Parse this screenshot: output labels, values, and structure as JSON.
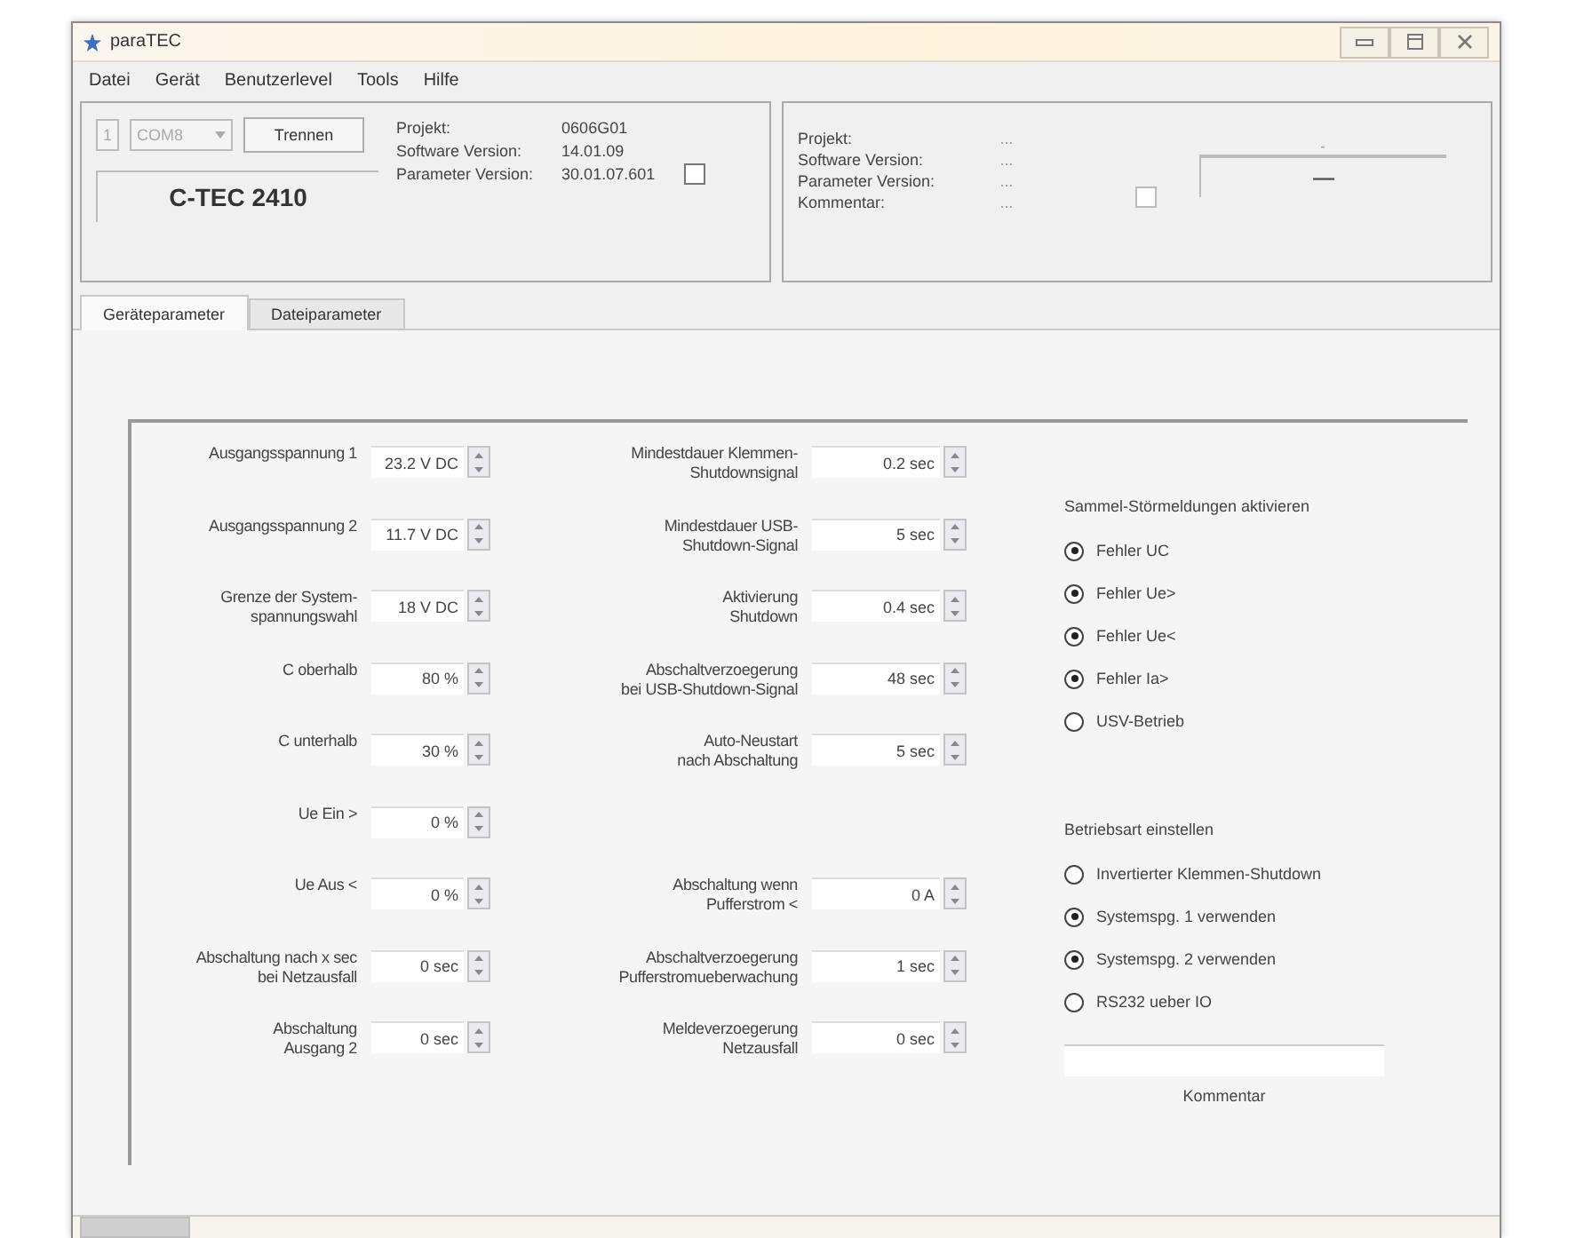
{
  "window": {
    "title": "paraTEC"
  },
  "menu": [
    "Datei",
    "Gerät",
    "Benutzerlevel",
    "Tools",
    "Hilfe"
  ],
  "connection": {
    "port_index": "1",
    "port": "COM8",
    "button": "Trennen",
    "device": "C-TEC 2410"
  },
  "device_info": [
    {
      "label": "Projekt:",
      "value": "0606G01"
    },
    {
      "label": "Software Version:",
      "value": "14.01.09"
    },
    {
      "label": "Parameter Version:",
      "value": "30.01.07.601"
    }
  ],
  "device_checkbox": {
    "checked": false
  },
  "file_info": [
    {
      "label": "Projekt:",
      "value": "..."
    },
    {
      "label": "Software Version:",
      "value": "..."
    },
    {
      "label": "Parameter Version:",
      "value": "..."
    },
    {
      "label": "Kommentar:",
      "value": "..."
    }
  ],
  "file_checkbox": {
    "checked": false
  },
  "file_display": {
    "caption": "-",
    "value": "—"
  },
  "tabs": [
    {
      "label": "Geräteparameter",
      "selected": true
    },
    {
      "label": "Dateiparameter",
      "selected": false
    }
  ],
  "rows": [
    {
      "left": {
        "label": "Ausgangsspannung 1",
        "value": "23.2 V DC"
      },
      "right": {
        "label": "Mindestdauer Klemmen-\nShutdownsignal",
        "value": "0.2 sec"
      }
    },
    {
      "left": {
        "label": "Ausgangsspannung 2",
        "value": "11.7 V DC"
      },
      "right": {
        "label": "Mindestdauer USB-\nShutdown-Signal",
        "value": "5 sec"
      }
    },
    {
      "left": {
        "label": "Grenze der System-\nspannungswahl",
        "value": "18 V DC"
      },
      "right": {
        "label": "Aktivierung\nShutdown",
        "value": "0.4 sec"
      }
    },
    {
      "left": {
        "label": "C oberhalb",
        "value": "80 %"
      },
      "right": {
        "label": "Abschaltverzoegerung\nbei USB-Shutdown-Signal",
        "value": "48 sec"
      }
    },
    {
      "left": {
        "label": "C unterhalb",
        "value": "30 %"
      },
      "right": {
        "label": "Auto-Neustart\nnach Abschaltung",
        "value": "5 sec"
      }
    },
    {
      "left": {
        "label": "Ue Ein >",
        "value": "0 %"
      }
    },
    {
      "left": {
        "label": "Ue Aus <",
        "value": "0 %"
      },
      "right": {
        "label": "Abschaltung wenn\nPufferstrom <",
        "value": "0 A"
      }
    },
    {
      "left": {
        "label": "Abschaltung nach x sec\nbei Netzausfall",
        "value": "0 sec"
      },
      "right": {
        "label": "Abschaltverzoegerung\nPufferstromueberwachung",
        "value": "1 sec"
      }
    },
    {
      "left": {
        "label": "Abschaltung\nAusgang 2",
        "value": "0 sec"
      },
      "right": {
        "label": "Meldeverzoegerung\nNetzausfall",
        "value": "0 sec"
      }
    }
  ],
  "groups": [
    {
      "title": "Sammel-Störmeldungen aktivieren",
      "options": [
        {
          "label": "Fehler UC",
          "checked": true
        },
        {
          "label": "Fehler Ue>",
          "checked": true
        },
        {
          "label": "Fehler Ue<",
          "checked": true
        },
        {
          "label": "Fehler Ia>",
          "checked": true
        },
        {
          "label": "USV-Betrieb",
          "checked": false
        }
      ]
    },
    {
      "title": "Betriebsart einstellen",
      "options": [
        {
          "label": "Invertierter Klemmen-Shutdown",
          "checked": false
        },
        {
          "label": "Systemspg. 1 verwenden",
          "checked": true
        },
        {
          "label": "Systemspg. 2 verwenden",
          "checked": true
        },
        {
          "label": "RS232 ueber IO",
          "checked": false
        }
      ]
    }
  ],
  "comment": {
    "label": "Kommentar"
  }
}
